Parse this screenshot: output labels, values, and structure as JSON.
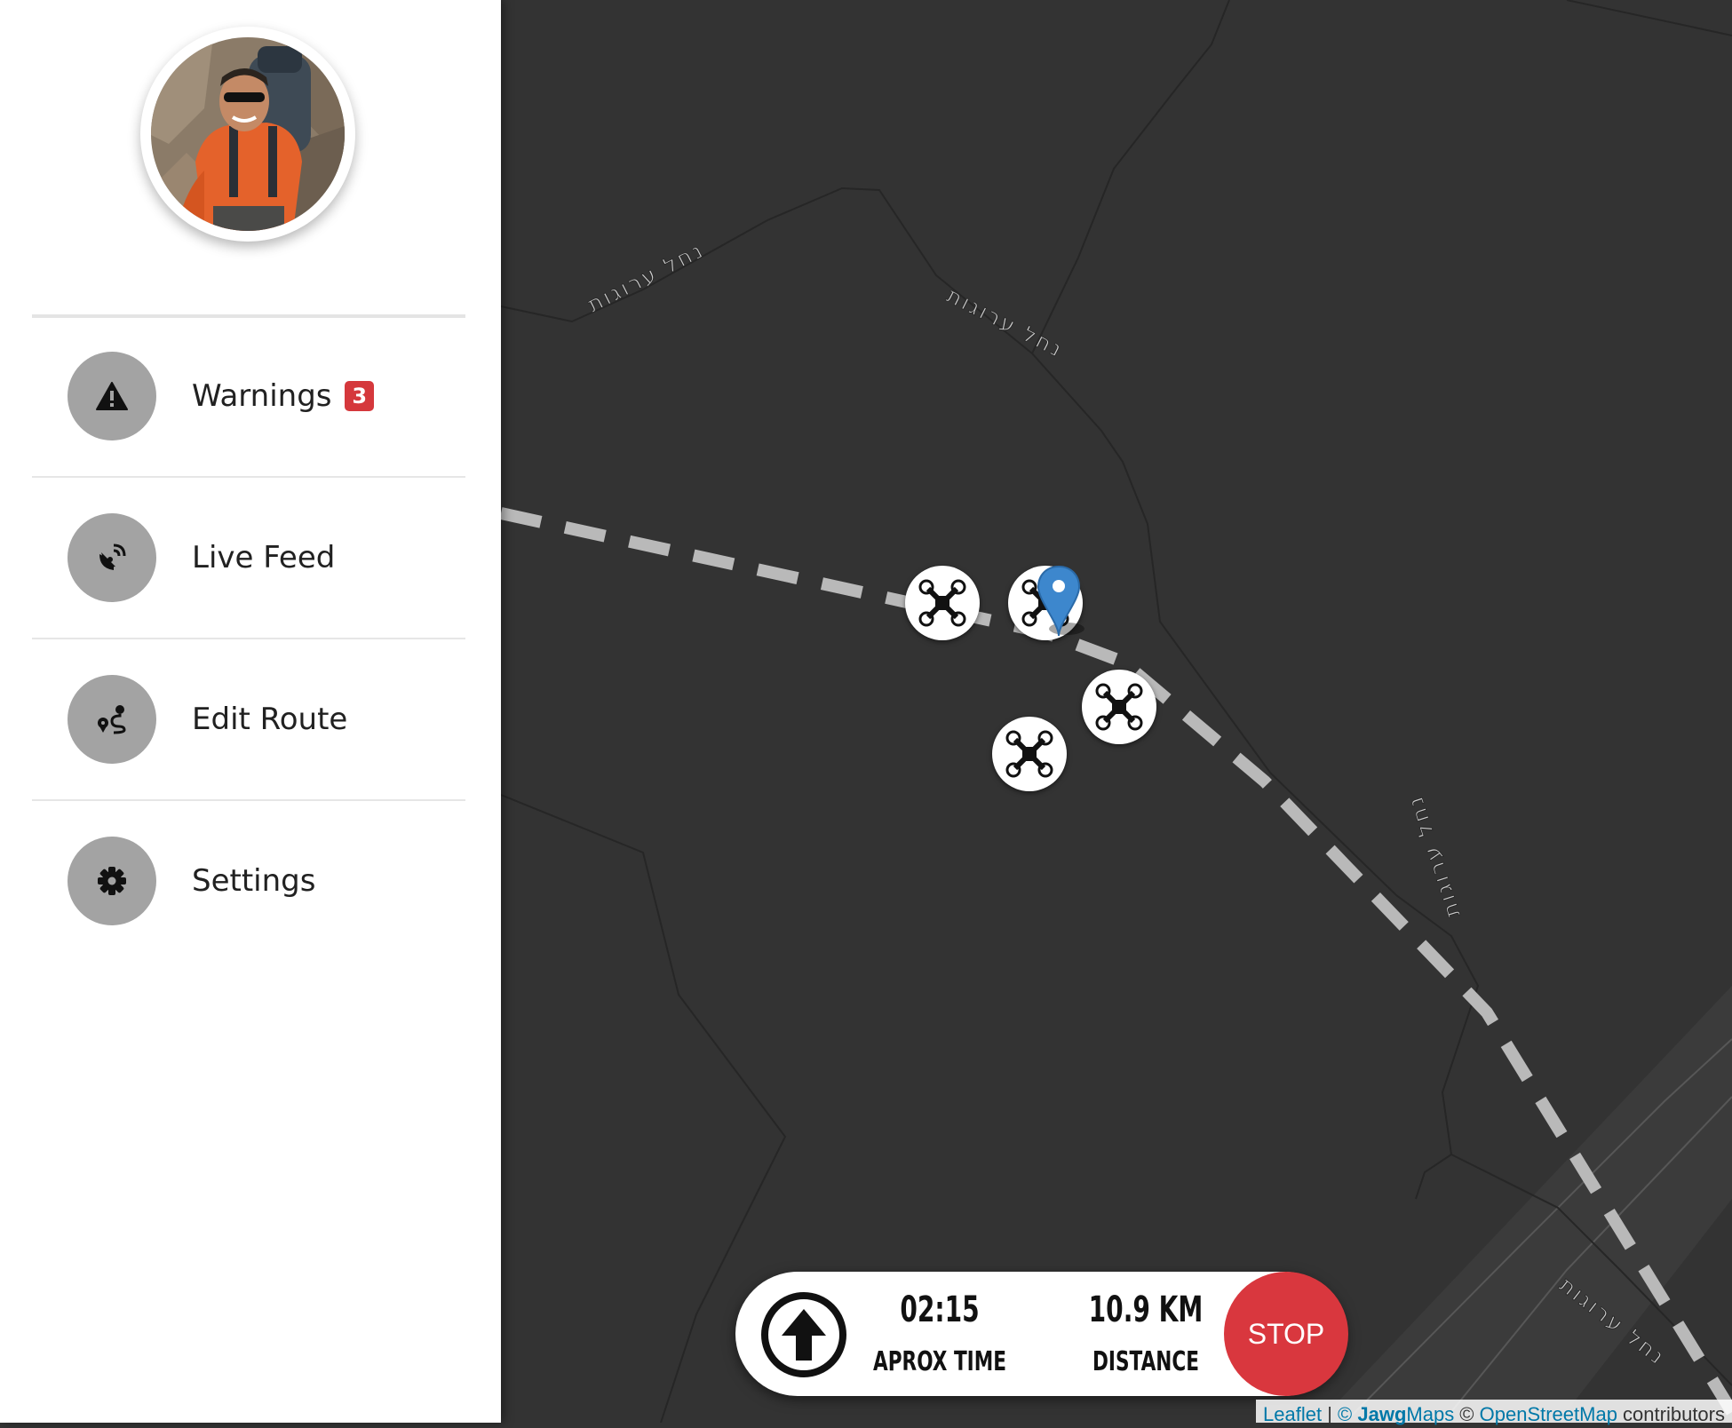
{
  "sidebar": {
    "menu": [
      {
        "id": "warnings",
        "label": "Warnings",
        "badge": "3",
        "icon": "warning-icon"
      },
      {
        "id": "live-feed",
        "label": "Live Feed",
        "icon": "satellite-dish-icon"
      },
      {
        "id": "edit-route",
        "label": "Edit Route",
        "icon": "route-icon"
      },
      {
        "id": "settings",
        "label": "Settings",
        "icon": "gear-icon"
      }
    ]
  },
  "map": {
    "street_labels": [
      "נחל ערוגות",
      "נחל ערוגות",
      "נחל ערוגות",
      "נחל ערוגות"
    ],
    "marker_icons": [
      "drone-icon",
      "map-pin-icon"
    ]
  },
  "navigation": {
    "time_value": "02:15",
    "time_label": "APROX TIME",
    "distance_value": "10.9 KM",
    "distance_label": "DISTANCE",
    "stop_label": "STOP",
    "direction_icon": "arrow-up-icon"
  },
  "attribution": {
    "leaflet": "Leaflet",
    "separator": " | ",
    "copyright1": "© ",
    "jawg": "Jawg",
    "maps": "Maps",
    "copyright2": " © ",
    "osm": "OpenStreetMap",
    "contributors": " contributors"
  },
  "colors": {
    "map_background": "#333333",
    "route": "#b9b9b9",
    "stop_button": "#d9373e",
    "badge": "#d5383c",
    "menu_icon_bg": "#a3a3a3",
    "pin": "#3d87cd"
  }
}
